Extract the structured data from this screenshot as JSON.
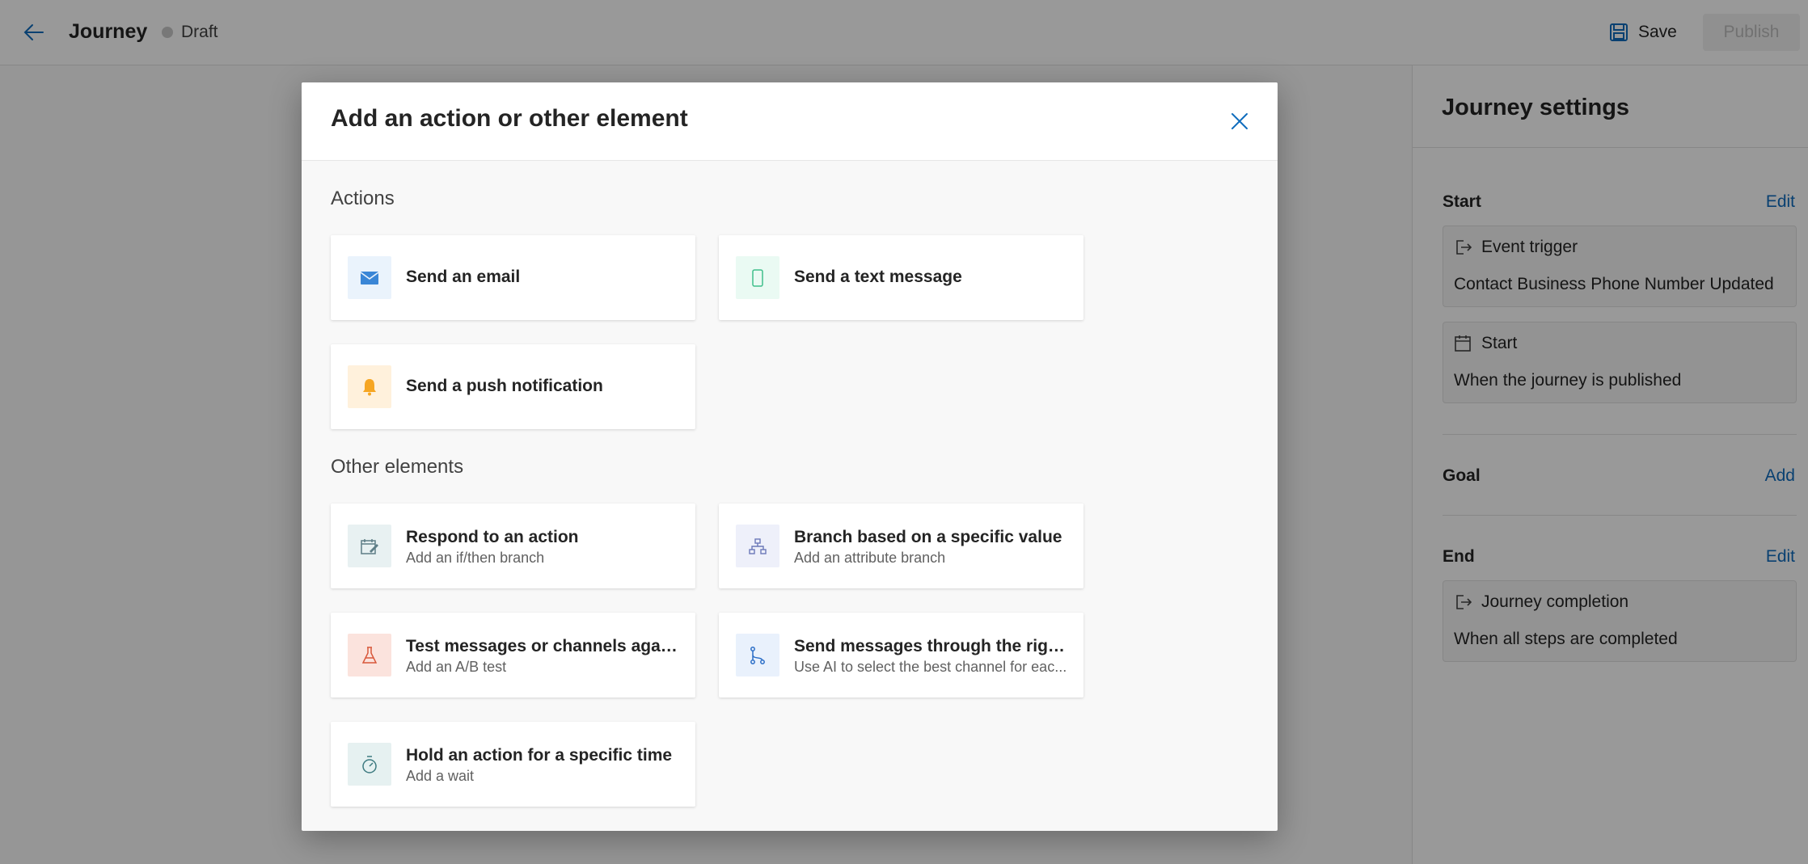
{
  "header": {
    "title": "Journey",
    "status": "Draft",
    "save_label": "Save",
    "publish_label": "Publish"
  },
  "settings": {
    "title": "Journey settings",
    "start": {
      "label": "Start",
      "link": "Edit",
      "trigger_title": "Event trigger",
      "trigger_value": "Contact Business Phone Number Updated",
      "schedule_title": "Start",
      "schedule_value": "When the journey is published"
    },
    "goal": {
      "label": "Goal",
      "link": "Add"
    },
    "end": {
      "label": "End",
      "link": "Edit",
      "completion_title": "Journey completion",
      "completion_value": "When all steps are completed"
    }
  },
  "modal": {
    "title": "Add an action or other element",
    "actions_heading": "Actions",
    "other_heading": "Other elements",
    "actions": [
      {
        "title": "Send an email",
        "icon": "mail-icon"
      },
      {
        "title": "Send a text message",
        "icon": "phone-icon"
      },
      {
        "title": "Send a push notification",
        "icon": "bell-icon"
      }
    ],
    "elements": [
      {
        "title": "Respond to an action",
        "subtitle": "Add an if/then branch",
        "icon": "respond-icon"
      },
      {
        "title": "Branch based on a specific value",
        "subtitle": "Add an attribute branch",
        "icon": "branch-icon"
      },
      {
        "title": "Test messages or channels agains...",
        "subtitle": "Add an A/B test",
        "icon": "flask-icon"
      },
      {
        "title": "Send messages through the right...",
        "subtitle": "Use AI to select the best channel for eac...",
        "icon": "route-icon"
      },
      {
        "title": "Hold an action for a specific time",
        "subtitle": "Add a wait",
        "icon": "timer-icon"
      }
    ]
  },
  "colors": {
    "accent": "#0f6cbd",
    "email_tint": "#eaf3fc",
    "text_tint": "#eafaf3",
    "push_tint": "#fff1dc",
    "respond_tint": "#e8f1f2",
    "branch_tint": "#eef0fa",
    "test_tint": "#fbe3dd",
    "route_tint": "#e9f1fc",
    "wait_tint": "#e6f1f1"
  }
}
